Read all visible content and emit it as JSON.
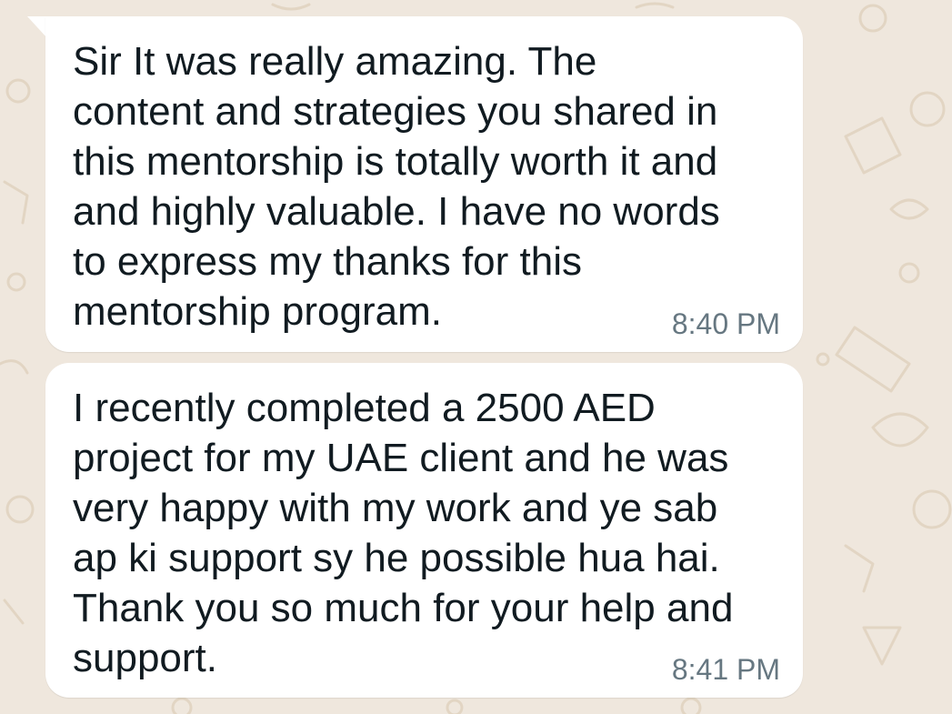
{
  "chat": {
    "background_color": "#efe7dd",
    "bubble_color": "#ffffff",
    "messages": [
      {
        "text": "Sir It was really amazing. The\ncontent and strategies you shared in\nthis mentorship is totally worth it and\nand highly valuable. I have no words\nto express my thanks for this\nmentorship program.",
        "time": "8:40 PM"
      },
      {
        "text": "I recently completed a 2500 AED\nproject for my UAE client and he was\nvery happy with my work and ye sab\nap ki support sy he possible hua hai.\nThank you so much for your help and\nsupport.",
        "time": "8:41 PM"
      }
    ]
  }
}
